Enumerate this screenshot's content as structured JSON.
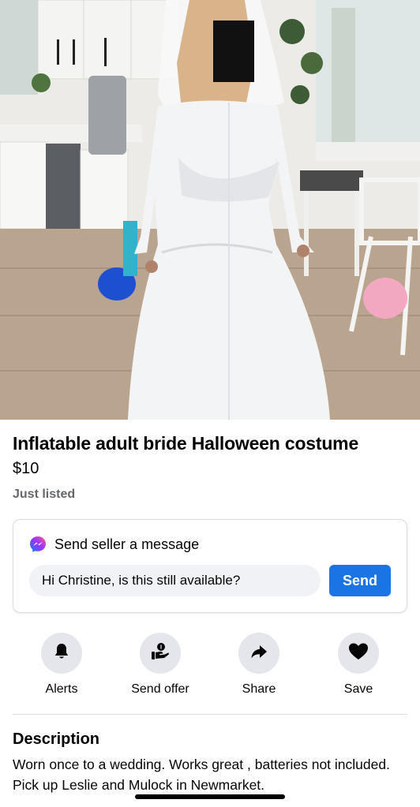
{
  "listing": {
    "title": "Inflatable adult bride Halloween costume",
    "price": "$10",
    "listed": "Just listed",
    "photo_icon": "listing-photo"
  },
  "message": {
    "heading": "Send seller a message",
    "input_value": "Hi Christine, is this still available?",
    "send_label": "Send",
    "icon": "messenger-icon"
  },
  "actions": [
    {
      "label": "Alerts",
      "icon": "bell-icon"
    },
    {
      "label": "Send offer",
      "icon": "offer-icon"
    },
    {
      "label": "Share",
      "icon": "share-icon"
    },
    {
      "label": "Save",
      "icon": "heart-icon"
    }
  ],
  "description": {
    "title": "Description",
    "body": "Worn once to a wedding. Works great , batteries not included. Pick up Leslie and Mulock in Newmarket."
  },
  "colors": {
    "accent": "#1b74e4",
    "secondary_text": "#65676b",
    "action_circle": "#e4e6eb",
    "input_bg": "#f0f2f5"
  }
}
